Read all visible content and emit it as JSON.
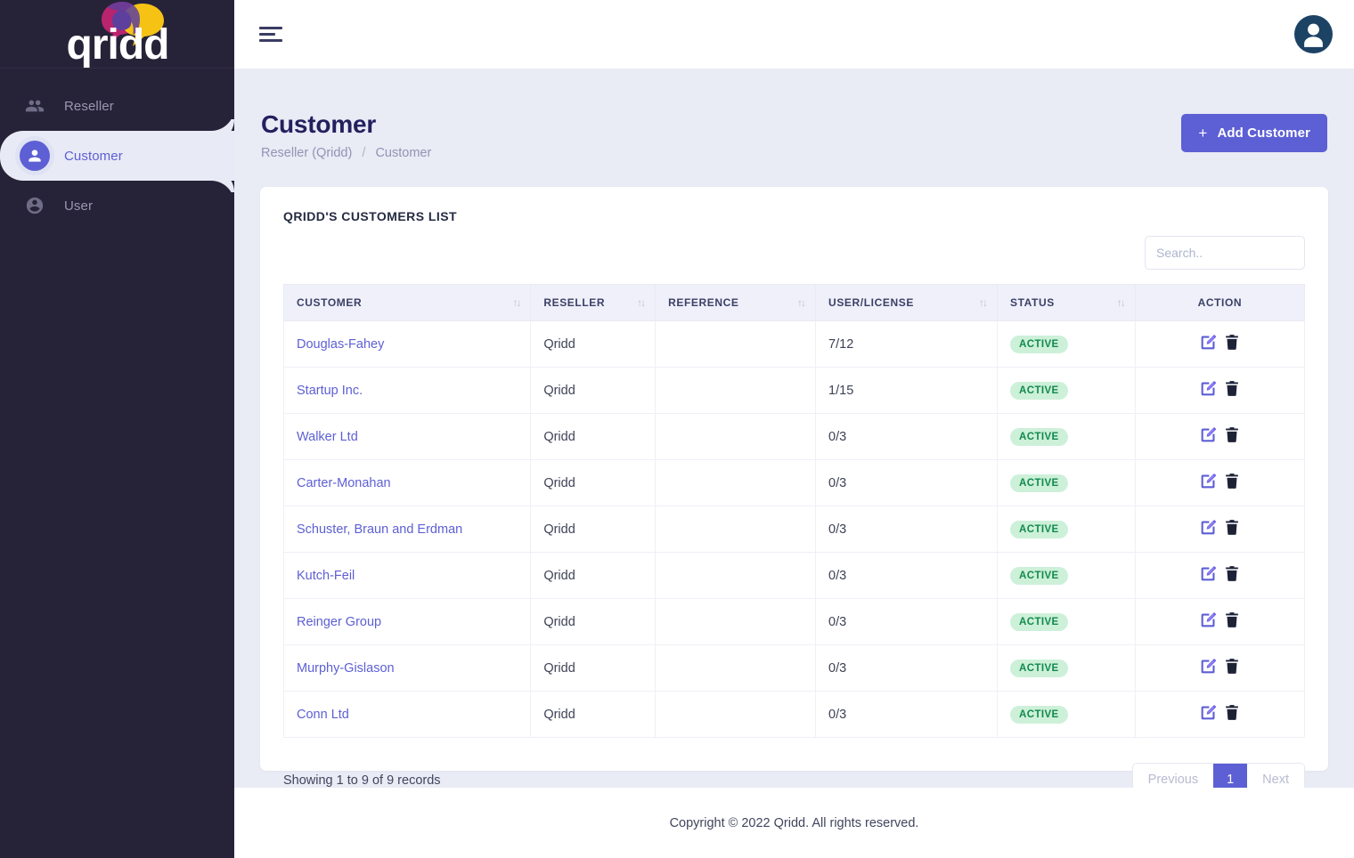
{
  "brand": {
    "name": "qridd",
    "logo_colors": {
      "pink": "#b8246d",
      "yellow": "#f6c315",
      "purple": "#5d3f9e"
    }
  },
  "sidebar": {
    "items": [
      {
        "label": "Reseller",
        "icon": "people-group-icon",
        "active": false
      },
      {
        "label": "Customer",
        "icon": "person-circle-icon",
        "active": true
      },
      {
        "label": "User",
        "icon": "account-circle-icon",
        "active": false
      }
    ]
  },
  "topbar": {
    "menu_icon": "hamburger-icon",
    "avatar_icon": "user-avatar-icon"
  },
  "page": {
    "title": "Customer",
    "breadcrumb": {
      "parent": "Reseller (Qridd)",
      "separator": "/",
      "current": "Customer"
    },
    "add_button": {
      "label": "Add Customer",
      "plus": "+"
    }
  },
  "card": {
    "title": "QRIDD'S CUSTOMERS LIST",
    "search": {
      "placeholder": "Search..",
      "value": ""
    }
  },
  "table": {
    "columns": [
      {
        "label": "CUSTOMER",
        "sortable": true
      },
      {
        "label": "RESELLER",
        "sortable": true
      },
      {
        "label": "REFERENCE",
        "sortable": true
      },
      {
        "label": "USER/LICENSE",
        "sortable": true
      },
      {
        "label": "STATUS",
        "sortable": true
      },
      {
        "label": "ACTION",
        "sortable": false
      }
    ],
    "sort_glyph": "↑↓",
    "rows": [
      {
        "customer": "Douglas-Fahey",
        "reseller": "Qridd",
        "reference": "",
        "user_license": "7/12",
        "status": "ACTIVE"
      },
      {
        "customer": "Startup Inc.",
        "reseller": "Qridd",
        "reference": "",
        "user_license": "1/15",
        "status": "ACTIVE"
      },
      {
        "customer": "Walker Ltd",
        "reseller": "Qridd",
        "reference": "",
        "user_license": "0/3",
        "status": "ACTIVE"
      },
      {
        "customer": "Carter-Monahan",
        "reseller": "Qridd",
        "reference": "",
        "user_license": "0/3",
        "status": "ACTIVE"
      },
      {
        "customer": "Schuster, Braun and Erdman",
        "reseller": "Qridd",
        "reference": "",
        "user_license": "0/3",
        "status": "ACTIVE"
      },
      {
        "customer": "Kutch-Feil",
        "reseller": "Qridd",
        "reference": "",
        "user_license": "0/3",
        "status": "ACTIVE"
      },
      {
        "customer": "Reinger Group",
        "reseller": "Qridd",
        "reference": "",
        "user_license": "0/3",
        "status": "ACTIVE"
      },
      {
        "customer": "Murphy-Gislason",
        "reseller": "Qridd",
        "reference": "",
        "user_license": "0/3",
        "status": "ACTIVE"
      },
      {
        "customer": "Conn Ltd",
        "reseller": "Qridd",
        "reference": "",
        "user_license": "0/3",
        "status": "ACTIVE"
      }
    ],
    "action_icons": {
      "edit": "edit-pencil-icon",
      "delete": "trash-icon"
    }
  },
  "pagination": {
    "records_text": "Showing 1 to 9 of 9 records",
    "previous": "Previous",
    "current_page": "1",
    "next": "Next"
  },
  "footer": {
    "copyright": "Copyright © 2022 Qridd. All rights reserved."
  },
  "colors": {
    "accent": "#5d5fd4",
    "sidebar_bg": "#262339",
    "content_bg": "#e9ebf5",
    "title": "#23205e",
    "status_green_bg": "#cdf0d9",
    "status_green_text": "#118a4b"
  }
}
